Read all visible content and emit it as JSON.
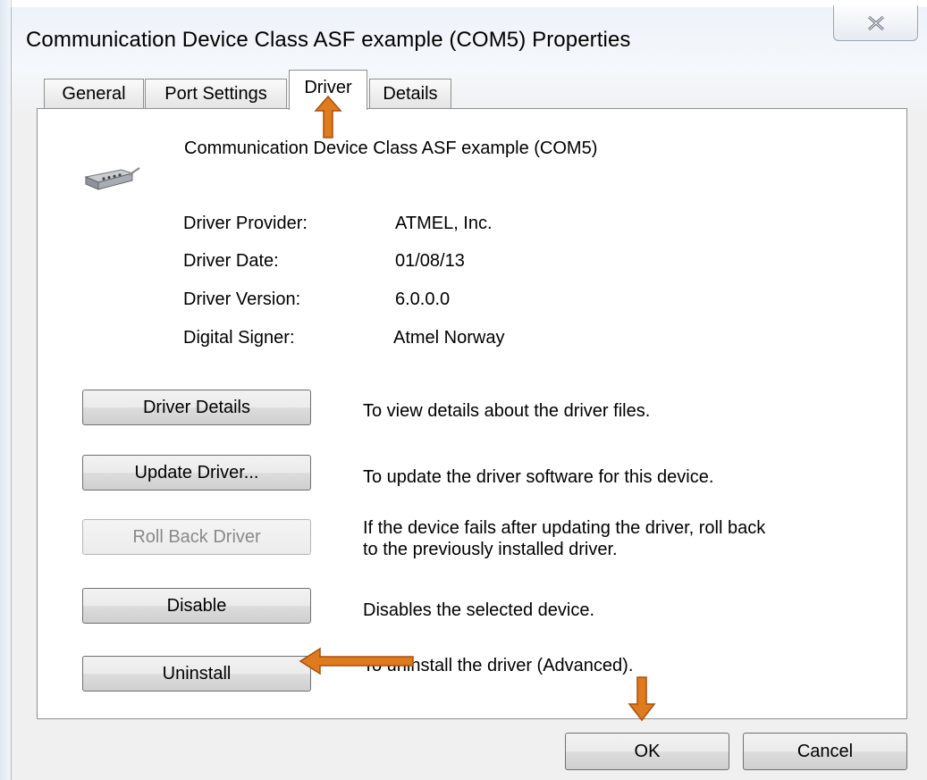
{
  "window": {
    "title": "Communication Device Class ASF example (COM5) Properties"
  },
  "tabs": [
    {
      "label": "General"
    },
    {
      "label": "Port Settings"
    },
    {
      "label": "Driver",
      "active": true
    },
    {
      "label": "Details"
    }
  ],
  "device": {
    "name": "Communication Device Class ASF example (COM5)",
    "icon": "serial-port-connector-icon"
  },
  "properties": [
    {
      "label": "Driver Provider:",
      "value": "ATMEL, Inc."
    },
    {
      "label": "Driver Date:",
      "value": "01/08/13"
    },
    {
      "label": "Driver Version:",
      "value": "6.0.0.0"
    },
    {
      "label": "Digital Signer:",
      "value": "Atmel Norway"
    }
  ],
  "actions": [
    {
      "label": "Driver Details",
      "description": "To view details about the driver files.",
      "enabled": true
    },
    {
      "label": "Update Driver...",
      "description": "To update the driver software for this device.",
      "enabled": true
    },
    {
      "label": "Roll Back Driver",
      "description_line1": "If the device fails after updating the driver, roll back",
      "description_line2": "to the previously installed driver.",
      "enabled": false
    },
    {
      "label": "Disable",
      "description": "Disables the selected device.",
      "enabled": true
    },
    {
      "label": "Uninstall",
      "description": "To uninstall the driver (Advanced).",
      "enabled": true
    }
  ],
  "footer": {
    "ok_label": "OK",
    "cancel_label": "Cancel"
  },
  "annotation": {
    "arrow_color": "#e07a1f"
  }
}
